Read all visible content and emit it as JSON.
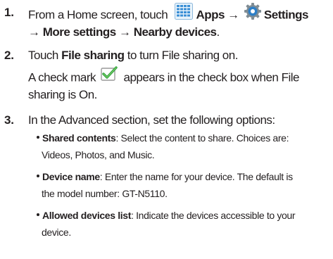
{
  "steps": [
    {
      "number": "1.",
      "lines": [
        {
          "pre": "From a Home screen, touch",
          "apps": "Apps",
          "arrow1": "→",
          "settings": "Settings"
        },
        {
          "arrow_a": "→",
          "more": "More settings",
          "arrow_b": "→",
          "nearby": "Nearby devices",
          "end": "."
        }
      ]
    },
    {
      "number": "2.",
      "touch": "Touch",
      "file_sharing": "File sharing",
      "rest": "to turn File sharing on.",
      "check_pre": "A check mark",
      "check_post": "appears in the check box when File",
      "check_cont": "sharing is On."
    },
    {
      "number": "3.",
      "intro": "In the Advanced section, set the following options:",
      "bullets": [
        {
          "term": "Shared contents",
          "text": ": Select the content to share. Choices are:",
          "cont": "Videos, Photos, and Music."
        },
        {
          "term": "Device name",
          "text": ": Enter the name for your device. The default is",
          "cont": "the model number: GT-N5110."
        },
        {
          "term": "Allowed devices list",
          "text": ": Indicate the devices accessible to your",
          "cont": "device."
        }
      ]
    }
  ],
  "icons": {
    "apps": "apps-grid-icon",
    "settings": "settings-gear-icon",
    "check": "check-mark-icon"
  },
  "colors": {
    "text": "#231f20",
    "apps_icon": "#3a8fd6",
    "settings_icon": "#2d7fc7",
    "check_green": "#2e9e3c"
  }
}
